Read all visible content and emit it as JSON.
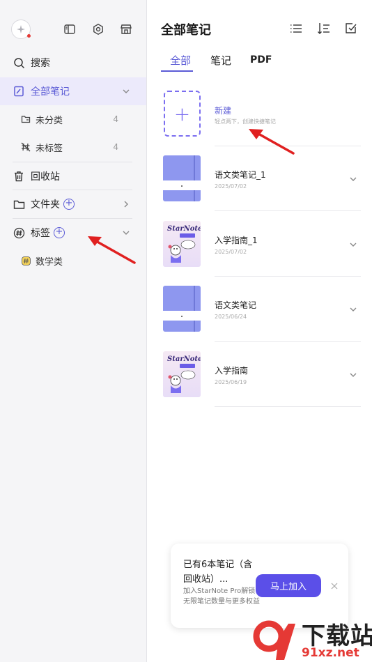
{
  "sidebar": {
    "search_label": "搜索",
    "all_notes_label": "全部笔记",
    "uncategorized_label": "未分类",
    "uncategorized_count": "4",
    "untagged_label": "未标签",
    "untagged_count": "4",
    "trash_label": "回收站",
    "folders_label": "文件夹",
    "tags_label": "标签",
    "tag_items": [
      {
        "label": "数学类"
      }
    ],
    "icons": [
      "sparkle-logo-icon",
      "sidebar-toggle-icon",
      "settings-icon",
      "store-icon"
    ]
  },
  "main": {
    "title": "全部笔记",
    "tabs": [
      {
        "label": "全部"
      },
      {
        "label": "笔记"
      },
      {
        "label": "PDF"
      }
    ],
    "active_tab": "全部",
    "new_note": {
      "title": "新建",
      "hint": "轻点两下，创建快捷笔记"
    },
    "notes": [
      {
        "title": "语文类笔记_1",
        "date": "2025/07/02",
        "cover": "notebook-blue"
      },
      {
        "title": "入学指南_1",
        "date": "2025/07/02",
        "cover": "starnote-guide"
      },
      {
        "title": "语文类笔记",
        "date": "2025/06/24",
        "cover": "notebook-blue"
      },
      {
        "title": "入学指南",
        "date": "2025/06/19",
        "cover": "starnote-guide"
      }
    ],
    "cover_text": "StarNote"
  },
  "promo": {
    "title": "已有6本笔记（含回收站）...",
    "description": "加入StarNote Pro解锁无限笔记数量与更多权益",
    "button_label": "马上加入"
  },
  "watermark": {
    "text": "下载站",
    "url": "91xz.net"
  },
  "colors": {
    "accent": "#5b5bd6",
    "button": "#5b4fe8",
    "arrow": "#e02020",
    "notebook": "#8e97ef"
  }
}
